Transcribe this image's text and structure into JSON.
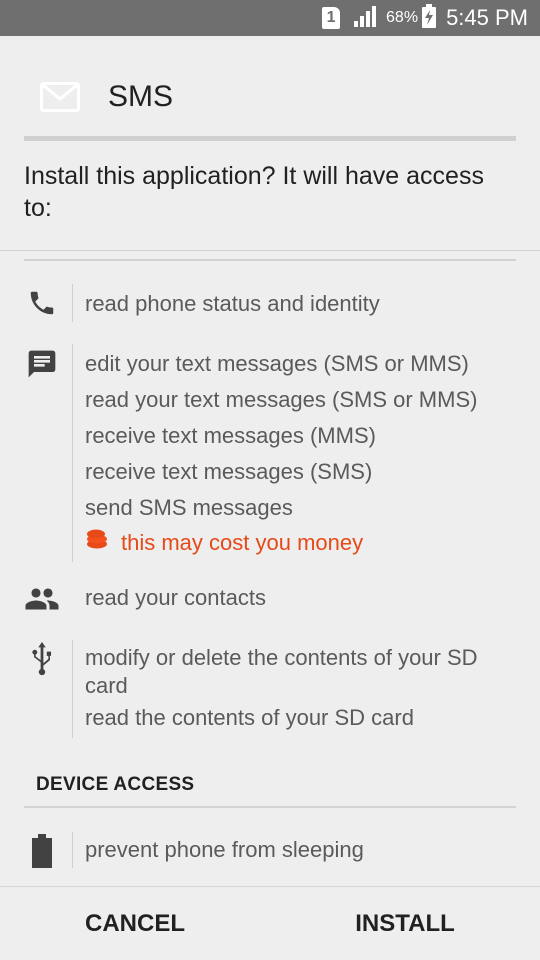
{
  "status_bar": {
    "sim": "1",
    "battery_pct": "68%",
    "time": "5:45 PM",
    "icons": [
      "sim-icon",
      "signal-icon",
      "battery-charging-icon"
    ]
  },
  "header": {
    "app_name": "SMS",
    "icon": "mail-icon"
  },
  "question": "Install this application? It will have access to:",
  "permissions": [
    {
      "icon": "phone-icon",
      "lines": [
        "read phone status and identity"
      ]
    },
    {
      "icon": "message-icon",
      "lines": [
        "edit your text messages (SMS or MMS)",
        "read your text messages (SMS or MMS)",
        "receive text messages (MMS)",
        "receive text messages (SMS)",
        "send SMS messages"
      ],
      "warning": "this may cost you money"
    },
    {
      "icon": "people-icon",
      "lines": [
        "read your contacts"
      ]
    },
    {
      "icon": "usb-icon",
      "lines": [
        "modify or delete the contents of your SD card",
        "read the contents of your SD card"
      ]
    }
  ],
  "device_access": {
    "heading": "DEVICE ACCESS",
    "permissions": [
      {
        "icon": "battery-icon",
        "lines": [
          "prevent phone from sleeping"
        ]
      }
    ]
  },
  "buttons": {
    "cancel": "CANCEL",
    "install": "INSTALL"
  },
  "colors": {
    "status_bar": "#6f6f6f",
    "background": "#eeeeee",
    "warning": "#e64a19",
    "text_secondary": "#5a5a5a"
  }
}
